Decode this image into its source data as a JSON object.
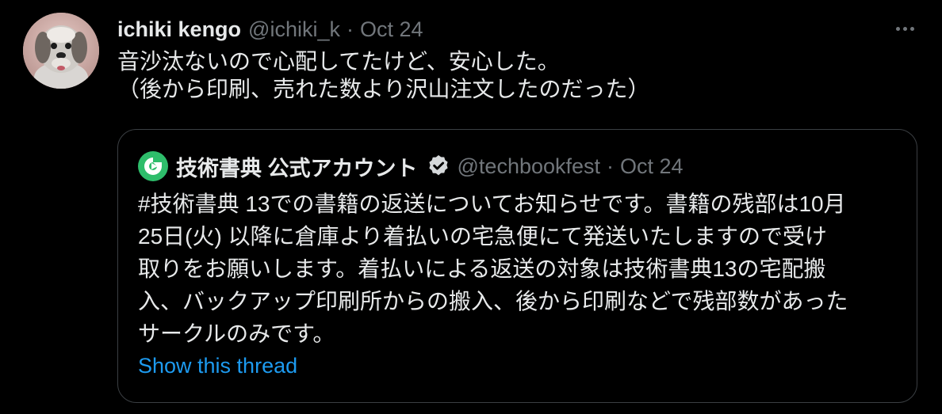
{
  "tweet": {
    "author_name": "ichiki kengo",
    "author_handle": "@ichiki_k",
    "separator": "·",
    "date": "Oct 24",
    "text": "音沙汰ないので心配してたけど、安心した。\n（後から印刷、売れた数より沢山注文したのだった）",
    "avatar_icon": "dog-avatar",
    "more_icon": "more-options-icon"
  },
  "quoted": {
    "logo_icon": "techbookfest-logo-icon",
    "author_name": "技術書典 公式アカウント",
    "verified_icon": "verified-badge-icon",
    "author_handle": "@techbookfest",
    "separator": "·",
    "date": "Oct 24",
    "text": "#技術書典 13での書籍の返送についてお知らせです。書籍の残部は10月\n25日(火) 以降に倉庫より着払いの宅急便にて発送いたしますので受け\n取りをお願いします。着払いによる返送の対象は技術書典13の宅配搬\n入、バックアップ印刷所からの搬入、後から印刷などで残部数があった\nサークルのみです。",
    "show_thread": "Show this thread"
  },
  "colors": {
    "background": "#000000",
    "text": "#e7e9ea",
    "muted": "#71767b",
    "link": "#1d9bf0",
    "border": "#3b3f43",
    "logo_green": "#2ebd6b"
  }
}
